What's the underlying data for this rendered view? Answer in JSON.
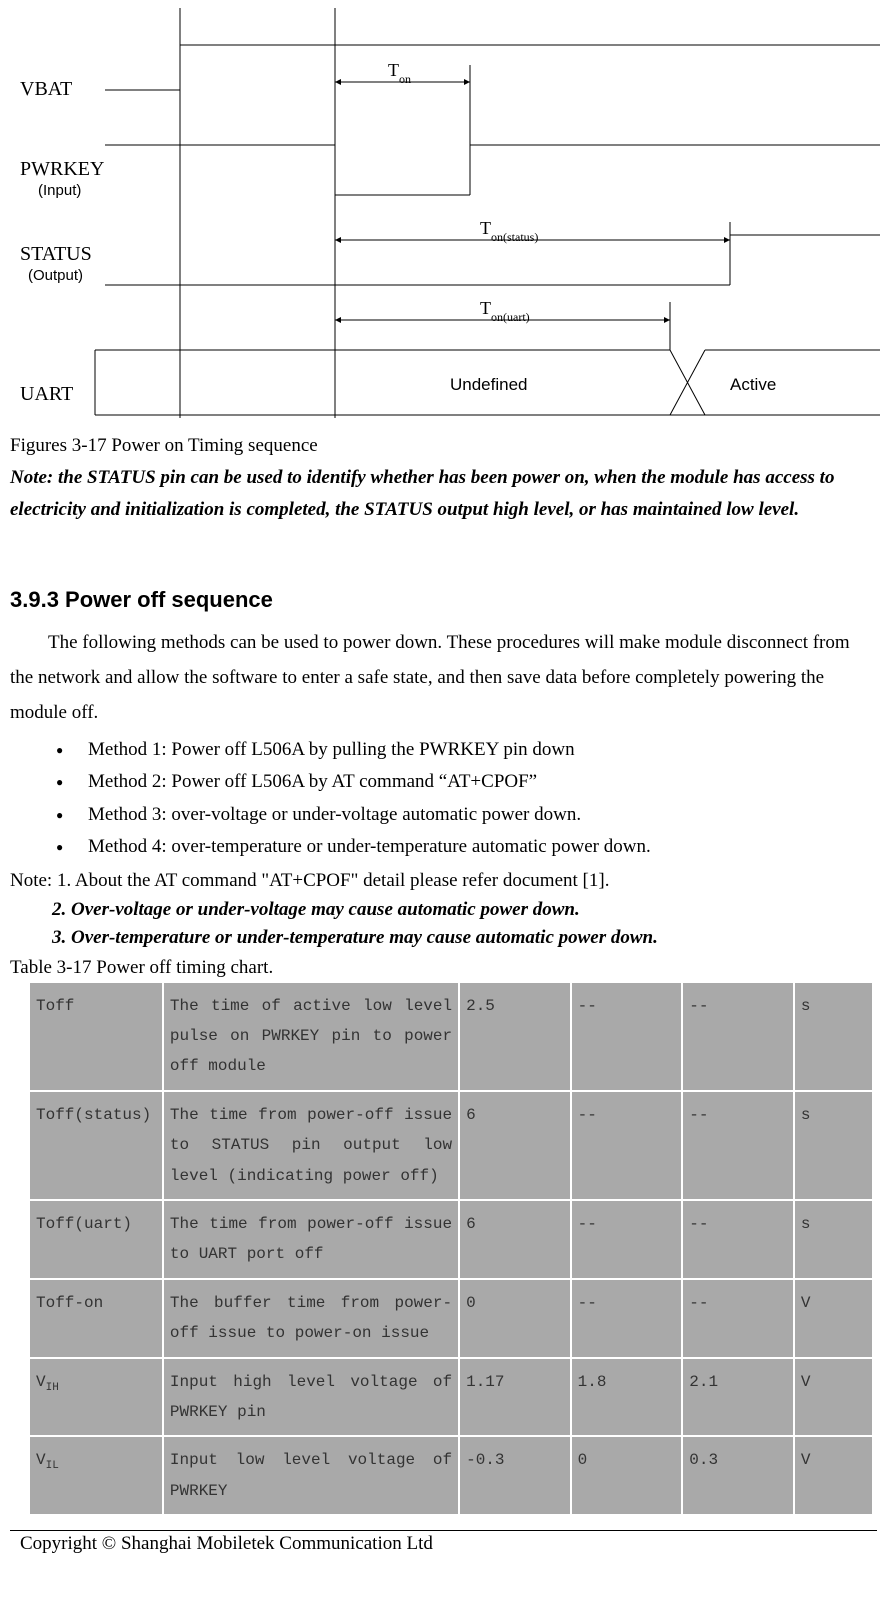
{
  "diagram": {
    "labels": {
      "vbat": "VBAT",
      "pwrkey": "PWRKEY",
      "pwrkey_sub": "(Input)",
      "status": "STATUS",
      "status_sub": "(Output)",
      "uart": "UART",
      "ton": "Tₒₙ",
      "ton_status": "Tₒₙ₍ₛₜₐₜᵤₛ₎",
      "ton_uart": "Tₒₙ₍ᵤₐᵣₜ₎",
      "undefined": "Undefined",
      "active": "Active"
    }
  },
  "fig_caption": "Figures 3-17 Power on Timing sequence",
  "fig_note": "Note: the STATUS pin can be used to identify whether has been power on, when the module has access to electricity and initialization is completed, the STATUS output high level, or has maintained low level.",
  "section_heading": "3.9.3 Power off sequence",
  "intro_para": "The following methods can be used to power down. These procedures will make module disconnect from the network and allow the software to enter a safe state, and then save data before completely powering the module off.",
  "methods": [
    "Method 1: Power off L506A by pulling the PWRKEY pin down",
    "Method 2: Power off L506A by AT command  “AT+CPOF”",
    "Method 3: over-voltage or under-voltage automatic power down.",
    "Method 4: over-temperature or under-temperature automatic power down."
  ],
  "notes": {
    "n1": "Note: 1. About the AT command \"AT+CPOF\" detail please refer document [1].",
    "n2": "2. Over-voltage or under-voltage may cause automatic power down.",
    "n3": "3. Over-temperature or under-temperature may cause automatic power down."
  },
  "table_caption": "Table 3-17 Power off timing chart.",
  "table_rows": [
    {
      "sym": "Toff",
      "desc": "The time of active low level pulse on PWRKEY pin to power off module",
      "v1": "2.5",
      "v2": "--",
      "v3": "--",
      "unit": "s"
    },
    {
      "sym": "Toff(status)",
      "desc": "The time from power-off issue to STATUS pin output low level (indicating power off)",
      "v1": "6",
      "v2": "--",
      "v3": "--",
      "unit": "s"
    },
    {
      "sym": "Toff(uart)",
      "desc": "The time from power-off issue to UART port off",
      "v1": "6",
      "v2": "--",
      "v3": "--",
      "unit": "s"
    },
    {
      "sym": "Toff-on",
      "desc": "The buffer time from power-off issue to power-on issue",
      "v1": "0",
      "v2": "--",
      "v3": "--",
      "unit": "V"
    },
    {
      "sym_html": "V<sub>IH</sub>",
      "sym": "VIH",
      "desc": "Input high level voltage of PWRKEY pin",
      "v1": "1.17",
      "v2": "1.8",
      "v3": "2.1",
      "unit": "V"
    },
    {
      "sym_html": "V<sub>IL</sub>",
      "sym": "VIL",
      "desc": "Input low level voltage of PWRKEY",
      "v1": "-0.3",
      "v2": "0",
      "v3": "0.3",
      "unit": "V"
    }
  ],
  "footer": "Copyright  ©  Shanghai  Mobiletek  Communication  Ltd"
}
